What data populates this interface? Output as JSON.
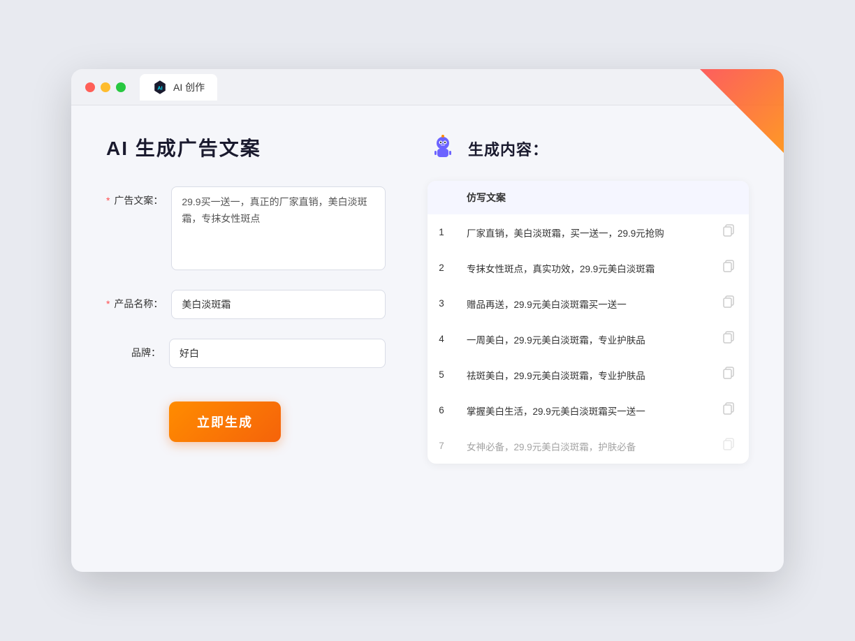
{
  "tab": {
    "title": "AI 创作"
  },
  "left": {
    "page_title": "AI 生成广告文案",
    "fields": [
      {
        "key": "ad_copy",
        "label": "广告文案：",
        "required": true,
        "type": "textarea",
        "value": "29.9买一送一，真正的厂家直销，美白淡斑霜，专抹女性斑点"
      },
      {
        "key": "product_name",
        "label": "产品名称：",
        "required": true,
        "type": "input",
        "value": "美白淡斑霜"
      },
      {
        "key": "brand",
        "label": "品牌：",
        "required": false,
        "type": "input",
        "value": "好白"
      }
    ],
    "generate_btn": "立即生成"
  },
  "right": {
    "title": "生成内容：",
    "table_header": "仿写文案",
    "results": [
      {
        "num": "1",
        "text": "厂家直销，美白淡斑霜，买一送一，29.9元抢购"
      },
      {
        "num": "2",
        "text": "专抹女性斑点，真实功效，29.9元美白淡斑霜"
      },
      {
        "num": "3",
        "text": "赠品再送，29.9元美白淡斑霜买一送一"
      },
      {
        "num": "4",
        "text": "一周美白，29.9元美白淡斑霜，专业护肤品"
      },
      {
        "num": "5",
        "text": "祛斑美白，29.9元美白淡斑霜，专业护肤品"
      },
      {
        "num": "6",
        "text": "掌握美白生活，29.9元美白淡斑霜买一送一"
      },
      {
        "num": "7",
        "text": "女神必备，29.9元美白淡斑霜，护肤必备"
      }
    ]
  }
}
